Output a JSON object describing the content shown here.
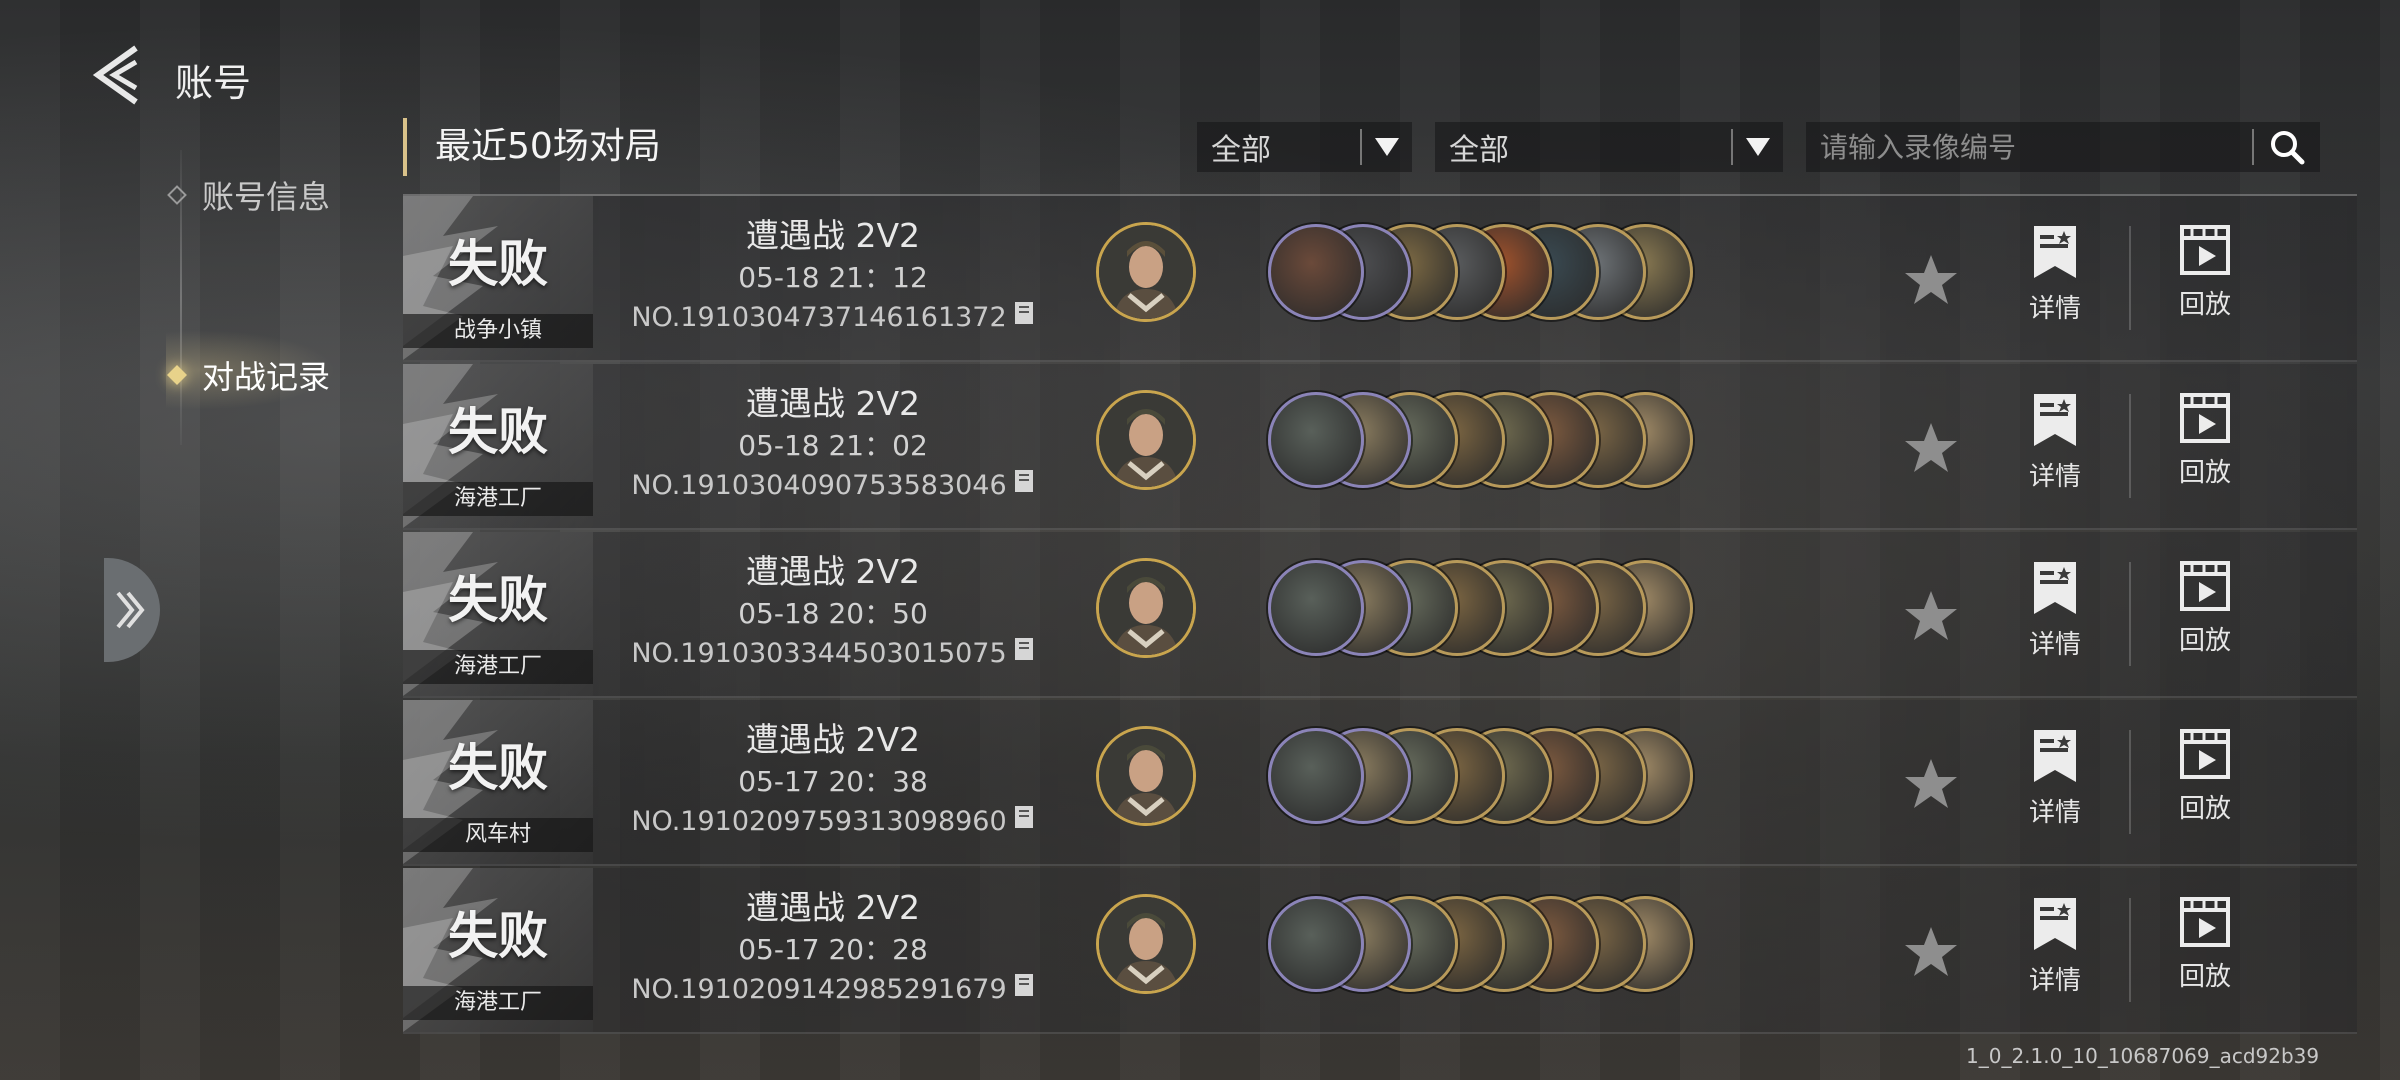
{
  "header": {
    "title": "账号"
  },
  "nav": {
    "items": [
      {
        "label": "账号信息",
        "active": false
      },
      {
        "label": "对战记录",
        "active": true
      }
    ]
  },
  "section": {
    "title": "最近50场对局"
  },
  "filters": {
    "filter1": {
      "value": "全部"
    },
    "filter2": {
      "value": "全部"
    },
    "search": {
      "placeholder": "请输入录像编号"
    }
  },
  "actions": {
    "detail_label": "详情",
    "replay_label": "回放"
  },
  "matches": [
    {
      "result": "失败",
      "map": "战争小镇",
      "mode": "遭遇战 2V2",
      "time": "05-18  21：12",
      "match_no": "NO.1910304737146161372",
      "commander": "commander-officer",
      "units": [
        "#6b4a3a",
        "#4e4f52",
        "#7d6a44",
        "#5b5d5f",
        "#a0522d",
        "#3a4a52",
        "#6f7478",
        "#8a7a52"
      ]
    },
    {
      "result": "失败",
      "map": "海港工厂",
      "mode": "遭遇战 2V2",
      "time": "05-18  21：02",
      "match_no": "NO.1910304090753583046",
      "commander": "commander-pilot",
      "units": [
        "#59605a",
        "#8a7c5f",
        "#666b5c",
        "#7b6542",
        "#6f6a4f",
        "#7d5a3f",
        "#7b6646",
        "#a08a66"
      ]
    },
    {
      "result": "失败",
      "map": "海港工厂",
      "mode": "遭遇战 2V2",
      "time": "05-18  20：50",
      "match_no": "NO.1910303344503015075",
      "commander": "commander-pilot",
      "units": [
        "#59605a",
        "#8a7c5f",
        "#666b5c",
        "#7b6542",
        "#6f6a4f",
        "#7d5a3f",
        "#7b6646",
        "#a08a66"
      ]
    },
    {
      "result": "失败",
      "map": "风车村",
      "mode": "遭遇战 2V2",
      "time": "05-17  20：38",
      "match_no": "NO.1910209759313098960",
      "commander": "commander-pilot",
      "units": [
        "#59605a",
        "#8a7c5f",
        "#666b5c",
        "#7b6542",
        "#6f6a4f",
        "#7d5a3f",
        "#7b6646",
        "#a08a66"
      ]
    },
    {
      "result": "失败",
      "map": "海港工厂",
      "mode": "遭遇战 2V2",
      "time": "05-17  20：28",
      "match_no": "NO.1910209142985291679",
      "commander": "commander-pilot",
      "units": [
        "#59605a",
        "#8a7c5f",
        "#666b5c",
        "#7b6542",
        "#6f6a4f",
        "#7d5a3f",
        "#7b6646",
        "#a08a66"
      ]
    }
  ],
  "version": "1_0_2.1.0_10_10687069_acd92b39"
}
